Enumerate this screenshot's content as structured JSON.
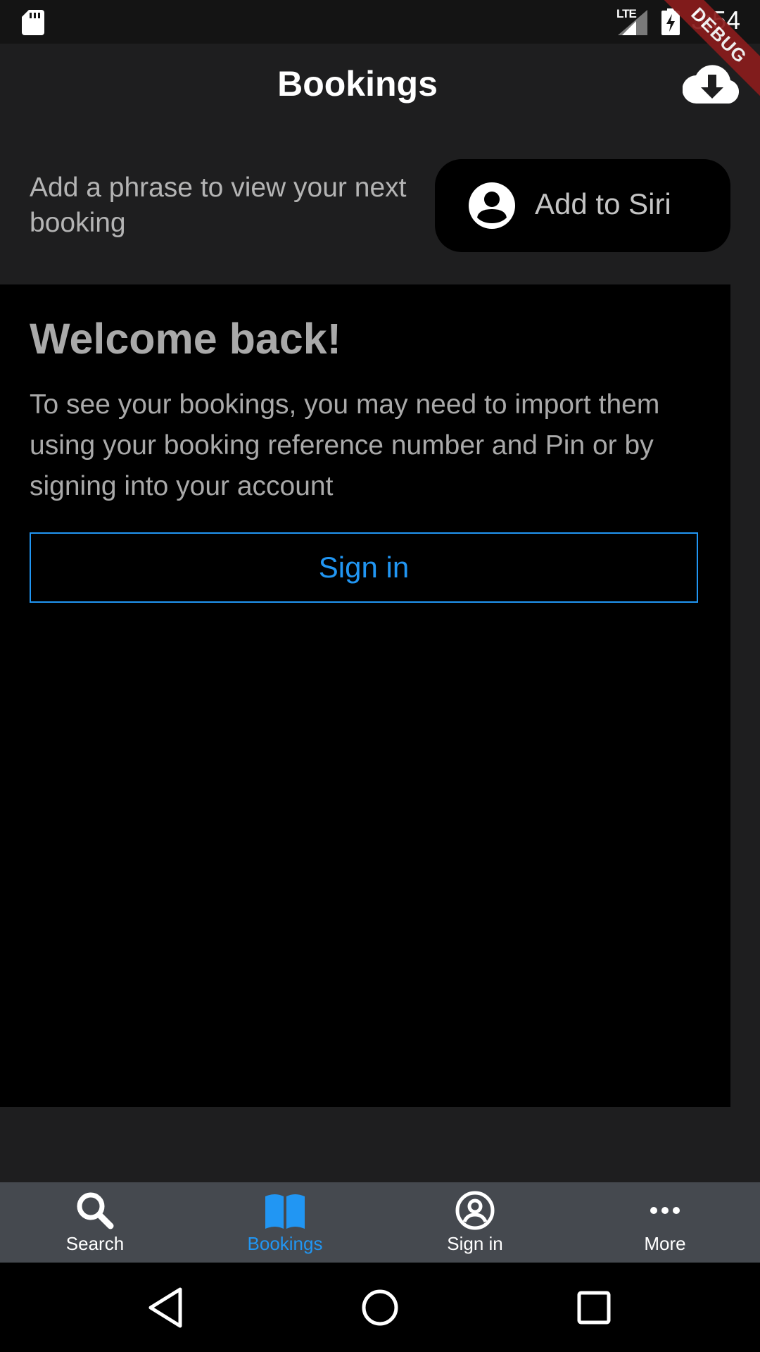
{
  "status_bar": {
    "network": "LTE",
    "time": "3:54"
  },
  "debug_banner": "DEBUG",
  "app_bar": {
    "title": "Bookings",
    "action_icon": "cloud-download-icon"
  },
  "siri": {
    "phrase_prompt": "Add a phrase to view your next booking",
    "button_label": "Add to Siri",
    "button_icon": "account-circle-icon"
  },
  "welcome": {
    "title": "Welcome back!",
    "body": "To see your bookings, you may need to import them using your booking reference number and Pin or by signing into your account",
    "sign_in_label": "Sign in"
  },
  "bottom_nav": {
    "items": [
      {
        "label": "Search",
        "icon": "search-icon",
        "active": false
      },
      {
        "label": "Bookings",
        "icon": "book-icon",
        "active": true
      },
      {
        "label": "Sign in",
        "icon": "account-circle-outline-icon",
        "active": false
      },
      {
        "label": "More",
        "icon": "more-horizontal-icon",
        "active": false
      }
    ]
  },
  "colors": {
    "accent": "#2196f3",
    "background": "#1e1e1f",
    "card": "#000000",
    "bottom_nav": "#45494f",
    "debug_ribbon": "#8a1c1c"
  }
}
